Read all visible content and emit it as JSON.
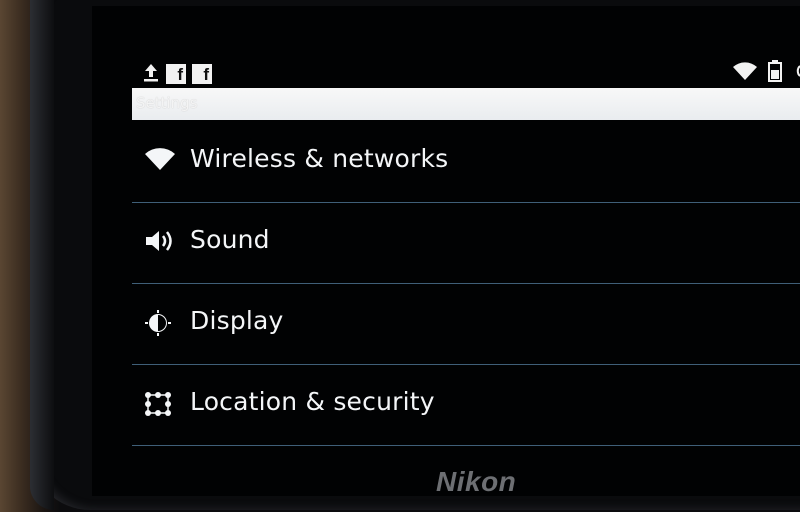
{
  "status_bar": {
    "left_icons": [
      "upload-icon",
      "facebook-icon",
      "facebook-icon"
    ],
    "right_icons": [
      "wifi-signal-icon",
      "battery-icon"
    ]
  },
  "title_bar": {
    "title": "Settings"
  },
  "settings_list": {
    "items": [
      {
        "label": "Wireless & networks",
        "icon": "wifi-icon"
      },
      {
        "label": "Sound",
        "icon": "speaker-icon"
      },
      {
        "label": "Display",
        "icon": "brightness-icon"
      },
      {
        "label": "Location & security",
        "icon": "location-grid-icon"
      }
    ]
  },
  "device": {
    "brand": "Nikon"
  },
  "colors": {
    "screen_background": "#010203",
    "title_bar": "#f4f6f8",
    "divider": "#3f5f78",
    "text": "#f4f6f8"
  }
}
